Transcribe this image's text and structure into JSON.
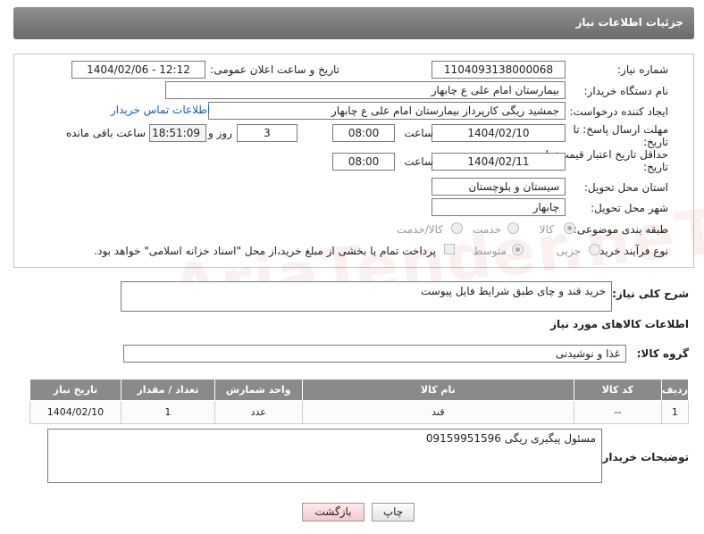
{
  "header": {
    "title": "جزئیات اطلاعات نیاز"
  },
  "form": {
    "need_number_label": "شماره نیاز:",
    "need_number": "1104093138000068",
    "announce_label": "تاریخ و ساعت اعلان عمومی:",
    "announce_value": "1404/02/06 - 12:12",
    "buyer_org_label": "نام دستگاه خریدار:",
    "buyer_org": "بیمارستان امام علی  ع  چابهار",
    "creator_label": "ایجاد کننده درخواست:",
    "creator": "جمشید ریگی کارپرداز بیمارستان امام علی  ع  چابهار",
    "contact_link": "اطلاعات تماس خریدار",
    "reply_deadline_label": "مهلت ارسال پاسخ: تا تاریخ:",
    "reply_date": "1404/02/10",
    "time_label": "ساعت",
    "reply_time": "08:00",
    "days_value": "3",
    "days_label": "روز و",
    "remaining_time": "18:51:09",
    "remaining_label": "ساعت باقی مانده",
    "price_deadline_label": "حداقل تاریخ اعتبار قیمت: تا تاریخ:",
    "price_date": "1404/02/11",
    "price_time": "08:00",
    "province_label": "استان محل تحویل:",
    "province": "سیستان و بلوچستان",
    "city_label": "شهر محل تحویل:",
    "city": "چابهار",
    "category_label": "طبقه بندی موضوعی:",
    "category_options": [
      "کالا",
      "خدمت",
      "کالا/خدمت"
    ],
    "process_label": "نوع فرآیند خرید :",
    "process_options": [
      "جزیی",
      "متوسط"
    ],
    "payment_note": "پرداخت تمام یا بخشی از مبلغ خرید،از محل \"اسناد خزانه اسلامی\" خواهد بود."
  },
  "description": {
    "label": "شرح کلی نیاز:",
    "value": "خرید قند و چای طبق شرایط فایل پیوست"
  },
  "goods": {
    "section_title": "اطلاعات کالاهای مورد نیاز",
    "group_label": "گروه کالا:",
    "group_value": "غذا و نوشیدنی",
    "columns": [
      "ردیف",
      "کد کالا",
      "نام کالا",
      "واحد شمارش",
      "تعداد / مقدار",
      "تاریخ نیاز"
    ],
    "rows": [
      {
        "index": "1",
        "code": "--",
        "name": "قند",
        "unit": "عدد",
        "qty": "1",
        "date": "1404/02/10"
      }
    ]
  },
  "buyer_notes": {
    "label": "توضیحات خریدار:",
    "value": "مسئول پیگیری ریگی 09159951596"
  },
  "buttons": {
    "print": "چاپ",
    "back": "بازگشت"
  },
  "watermark": "AriaTender.neT"
}
